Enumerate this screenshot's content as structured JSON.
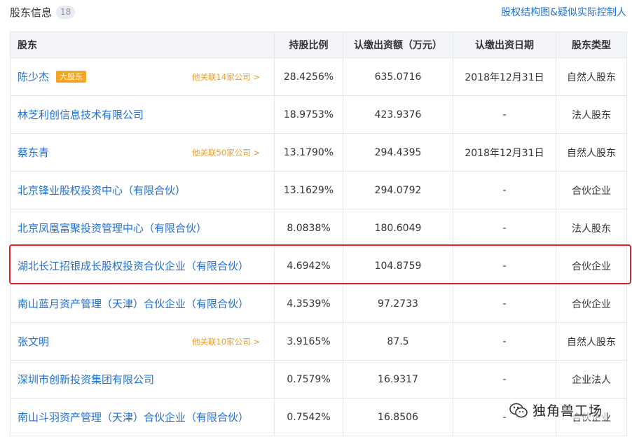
{
  "header": {
    "title": "股东信息",
    "count": "18",
    "link": "股权结构图&疑似实际控制人"
  },
  "table": {
    "columns": [
      "股东",
      "持股比例",
      "认缴出资额（万元）",
      "认缴出资日期",
      "股东类型"
    ],
    "rows": [
      {
        "name": "陈少杰",
        "badge": "大股东",
        "related": "他关联14家公司 >",
        "ratio": "28.4256%",
        "amount": "635.0716",
        "date": "2018年12月31日",
        "type": "自然人股东"
      },
      {
        "name": "林芝利创信息技术有限公司",
        "badge": "",
        "related": "",
        "ratio": "18.9753%",
        "amount": "423.9376",
        "date": "-",
        "type": "法人股东"
      },
      {
        "name": "蔡东青",
        "badge": "",
        "related": "他关联50家公司 >",
        "ratio": "13.1790%",
        "amount": "294.4395",
        "date": "2018年12月31日",
        "type": "自然人股东"
      },
      {
        "name": "北京锋业股权投资中心（有限合伙）",
        "badge": "",
        "related": "",
        "ratio": "13.1629%",
        "amount": "294.0792",
        "date": "-",
        "type": "合伙企业"
      },
      {
        "name": "北京凤凰富聚投资管理中心（有限合伙）",
        "badge": "",
        "related": "",
        "ratio": "8.0838%",
        "amount": "180.6049",
        "date": "-",
        "type": "法人股东"
      },
      {
        "name": "湖北长江招银成长股权投资合伙企业（有限合伙）",
        "badge": "",
        "related": "",
        "ratio": "4.6942%",
        "amount": "104.8759",
        "date": "-",
        "type": "合伙企业"
      },
      {
        "name": "南山蓝月资产管理（天津）合伙企业（有限合伙）",
        "badge": "",
        "related": "",
        "ratio": "4.3539%",
        "amount": "97.2733",
        "date": "-",
        "type": "合伙企业"
      },
      {
        "name": "张文明",
        "badge": "",
        "related": "他关联10家公司 >",
        "ratio": "3.9165%",
        "amount": "87.5",
        "date": "-",
        "type": "自然人股东"
      },
      {
        "name": "深圳市创新投资集团有限公司",
        "badge": "",
        "related": "",
        "ratio": "0.7579%",
        "amount": "16.9317",
        "date": "-",
        "type": "企业法人"
      },
      {
        "name": "南山斗羽资产管理（天津）合伙企业（有限合伙）",
        "badge": "",
        "related": "",
        "ratio": "0.7542%",
        "amount": "16.8506",
        "date": "-",
        "type": "合伙企业"
      }
    ]
  },
  "watermark": {
    "text": "独角兽工场",
    "icon": "wechat-icon"
  },
  "colors": {
    "link": "#1f6fd6",
    "related": "#f09a23",
    "badge": "#f5a623",
    "highlight": "#d9262b"
  }
}
